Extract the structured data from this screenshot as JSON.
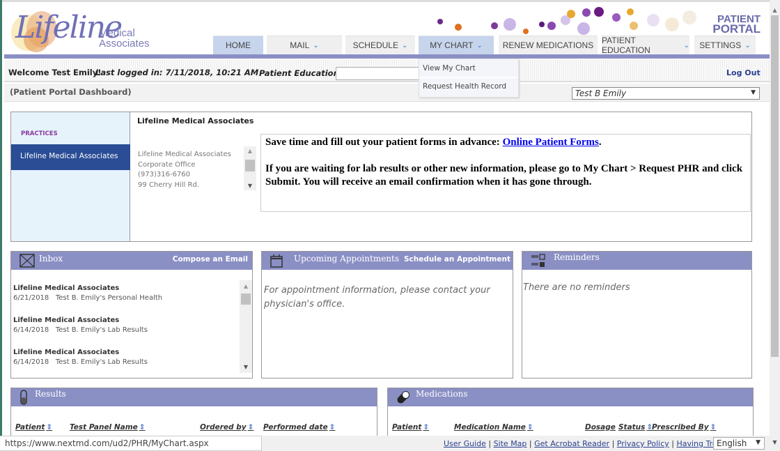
{
  "header": {
    "logo_script": "Lifeline",
    "logo_line1": "Medical",
    "logo_line2": "Associates",
    "portal_line1": "PATIENT",
    "portal_line2": "PORTAL"
  },
  "nav": [
    {
      "label": "HOME",
      "dropdown": false,
      "active": false
    },
    {
      "label": "MAIL",
      "dropdown": true
    },
    {
      "label": "SCHEDULE",
      "dropdown": true
    },
    {
      "label": "MY CHART",
      "dropdown": true
    },
    {
      "label": "RENEW MEDICATIONS",
      "dropdown": false
    },
    {
      "label": "PATIENT EDUCATION",
      "dropdown": true
    },
    {
      "label": "SETTINGS",
      "dropdown": true
    }
  ],
  "mychart_menu": [
    "View My Chart",
    "Request Health Record"
  ],
  "welcome": {
    "text": "Welcome Test Emily!",
    "last_logged": "Last logged in: 7/11/2018, 10:21 AM",
    "patient_ed_label": "Patient Education",
    "patient_ed_value": "",
    "logout": "Log Out"
  },
  "dashboard": {
    "title": "(Patient Portal Dashboard)",
    "patient_select": "Test B Emily"
  },
  "practices": {
    "heading": "PRACTICES",
    "selected": "Lifeline Medical Associates",
    "name": "Lifeline Medical Associates",
    "address": [
      "Lifeline Medical Associates",
      "Corporate Office",
      "(973)316-6760",
      "99 Cherry Hill Rd."
    ],
    "message_line1_pre": "Save time and fill out your patient forms in advance: ",
    "message_link": "Online Patient Forms",
    "message_line1_post": ".",
    "message_line2": "If you are waiting for lab results or other new information, please go to My Chart > Request PHR and click Submit. You will receive an email confirmation when it has gone through."
  },
  "inbox": {
    "title": "Inbox",
    "action": "Compose an Email",
    "items": [
      {
        "from": "Lifeline Medical Associates",
        "date": "6/21/2018",
        "subject": "Test B. Emily's Personal Health"
      },
      {
        "from": "Lifeline Medical Associates",
        "date": "6/14/2018",
        "subject": "Test B. Emily's Lab Results"
      },
      {
        "from": "Lifeline Medical Associates",
        "date": "6/14/2018",
        "subject": "Test B. Emily's Lab Results"
      }
    ]
  },
  "appointments": {
    "title": "Upcoming Appointments",
    "action": "Schedule an Appointment",
    "message": "For appointment information, please contact your physician's office."
  },
  "reminders": {
    "title": "Reminders",
    "message": "There are no reminders"
  },
  "results": {
    "title": "Results",
    "columns": [
      "Patient",
      "Test Panel Name",
      "Ordered by",
      "Performed date"
    ]
  },
  "medications": {
    "title": "Medications",
    "columns": [
      "Patient",
      "Medication Name",
      "Dosage",
      "Status",
      "Prescribed By"
    ]
  },
  "status_url": "https://www.nextmd.com/ud2/PHR/MyChart.aspx",
  "footer": {
    "links": [
      "User Guide",
      "Site Map",
      "Get Acrobat Reader",
      "Privacy Policy",
      "Having Trouble?"
    ],
    "language": "English"
  },
  "colors": {
    "accent": "#8a8fc4",
    "selected": "#2a4d95",
    "menu_active": "#c6d4ec"
  }
}
